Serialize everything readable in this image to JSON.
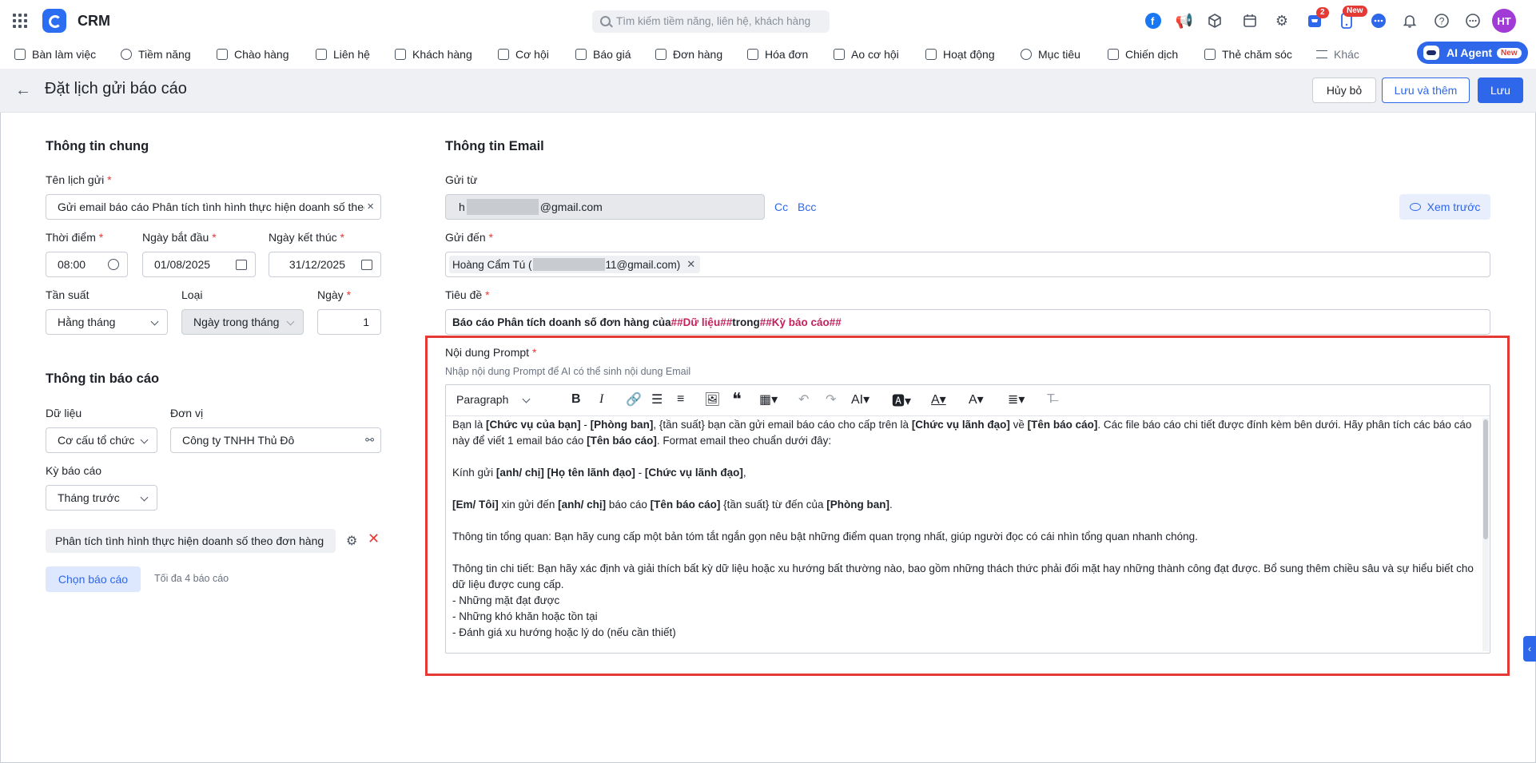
{
  "app": {
    "name": "CRM"
  },
  "search": {
    "placeholder": "Tìm kiếm tiềm năng, liên hệ, khách hàng"
  },
  "top_icons": {
    "cart_badge": "2",
    "mobile_badge": "New",
    "avatar": "HT"
  },
  "nav": {
    "items": [
      "Bàn làm việc",
      "Tiềm năng",
      "Chào hàng",
      "Liên hệ",
      "Khách hàng",
      "Cơ hội",
      "Báo giá",
      "Đơn hàng",
      "Hóa đơn",
      "Ao cơ hội",
      "Hoạt động",
      "Mục tiêu",
      "Chiến dịch",
      "Thẻ chăm sóc",
      "Khác"
    ],
    "ai_agent": "AI Agent",
    "ai_new": "New"
  },
  "header": {
    "title": "Đặt lịch gửi báo cáo",
    "cancel": "Hủy bỏ",
    "save_add": "Lưu và thêm",
    "save": "Lưu"
  },
  "general": {
    "title": "Thông tin chung",
    "name_label": "Tên lịch gửi",
    "name_value": "Gửi email báo cáo Phân tích tình hình thực hiện doanh số theo",
    "time_label": "Thời điểm",
    "time_value": "08:00",
    "start_label": "Ngày bắt đầu",
    "start_value": "01/08/2025",
    "end_label": "Ngày kết thúc",
    "end_value": "31/12/2025",
    "freq_label": "Tần suất",
    "freq_value": "Hằng tháng",
    "type_label": "Loại",
    "type_value": "Ngày trong tháng",
    "day_label": "Ngày",
    "day_value": "1",
    "required_mark": "*"
  },
  "report": {
    "title": "Thông tin báo cáo",
    "data_label": "Dữ liệu",
    "data_value": "Cơ cấu tổ chức",
    "unit_label": "Đơn vị",
    "unit_value": "Công ty TNHH Thủ Đô",
    "period_label": "Kỳ báo cáo",
    "period_value": "Tháng trước",
    "selected_report": "Phân tích tình hình thực hiện doanh số theo đơn hàng",
    "choose_button": "Chọn báo cáo",
    "limit_hint": "Tối đa 4 báo cáo"
  },
  "email": {
    "title": "Thông tin Email",
    "from_label": "Gửi từ",
    "from_prefix": "h",
    "from_suffix": "@gmail.com",
    "cc": "Cc",
    "bcc": "Bcc",
    "preview": "Xem trước",
    "to_label": "Gửi đến",
    "to_name": "Hoàng Cẩm Tú (",
    "to_suffix": "11@gmail.com)",
    "subject_label": "Tiêu đề",
    "subject_a": "Báo cáo Phân tích doanh số đơn hàng của ",
    "subject_var1": "##Dữ liệu##",
    "subject_b": " trong ",
    "subject_var2": "##Kỳ báo cáo##",
    "prompt_label": "Nội dung Prompt",
    "prompt_hint": "Nhập nội dung Prompt để AI có thể sinh nội dung Email",
    "paragraph": "Paragraph"
  },
  "prompt": {
    "l1a": "Bạn là ",
    "l1b": "[Chức vụ của bạn]",
    "l1c": " - ",
    "l1d": "[Phòng ban]",
    "l1e": ", {tần suất} bạn cần gửi email báo cáo cho cấp trên là ",
    "l1f": "[Chức vụ lãnh đạo]",
    "l1g": " về ",
    "l1h": "[Tên báo cáo]",
    "l1i": ". Các file báo cáo chi tiết được đính kèm bên dưới. Hãy phân tích các báo cáo này để viết 1 email báo cáo ",
    "l1j": "[Tên báo cáo]",
    "l1k": ". Format email theo chuẩn dưới đây:",
    "l2a": "Kính gửi ",
    "l2b": "[anh/ chị] [Họ tên lãnh đạo]",
    "l2c": " - ",
    "l2d": "[Chức vụ lãnh đạo]",
    "l2e": ",",
    "l3a": "[Em/ Tôi]",
    "l3b": " xin gửi đến ",
    "l3c": "[anh/ chị]",
    "l3d": " báo cáo ",
    "l3e": "[Tên báo cáo]",
    "l3f": " {tần suất} từ đến của ",
    "l3g": "[Phòng ban]",
    "l3h": ".",
    "l4": "Thông tin tổng quan: Bạn hãy cung cấp một bản tóm tắt ngắn gọn nêu bật những điểm quan trọng nhất, giúp người đọc có cái nhìn tổng quan nhanh chóng.",
    "l5": "Thông tin chi tiết: Bạn hãy xác định và giải thích bất kỳ dữ liệu hoặc xu hướng bất thường nào, bao gồm những thách thức phải đối mặt hay những thành công đạt được. Bổ sung thêm chiều sâu và sự hiểu biết cho dữ liệu được cung cấp.",
    "l6": "- Những mặt đạt được",
    "l7": "- Những khó khăn hoặc tồn tại",
    "l8": "- Đánh giá xu hướng hoặc lý do (nếu cần thiết)"
  }
}
